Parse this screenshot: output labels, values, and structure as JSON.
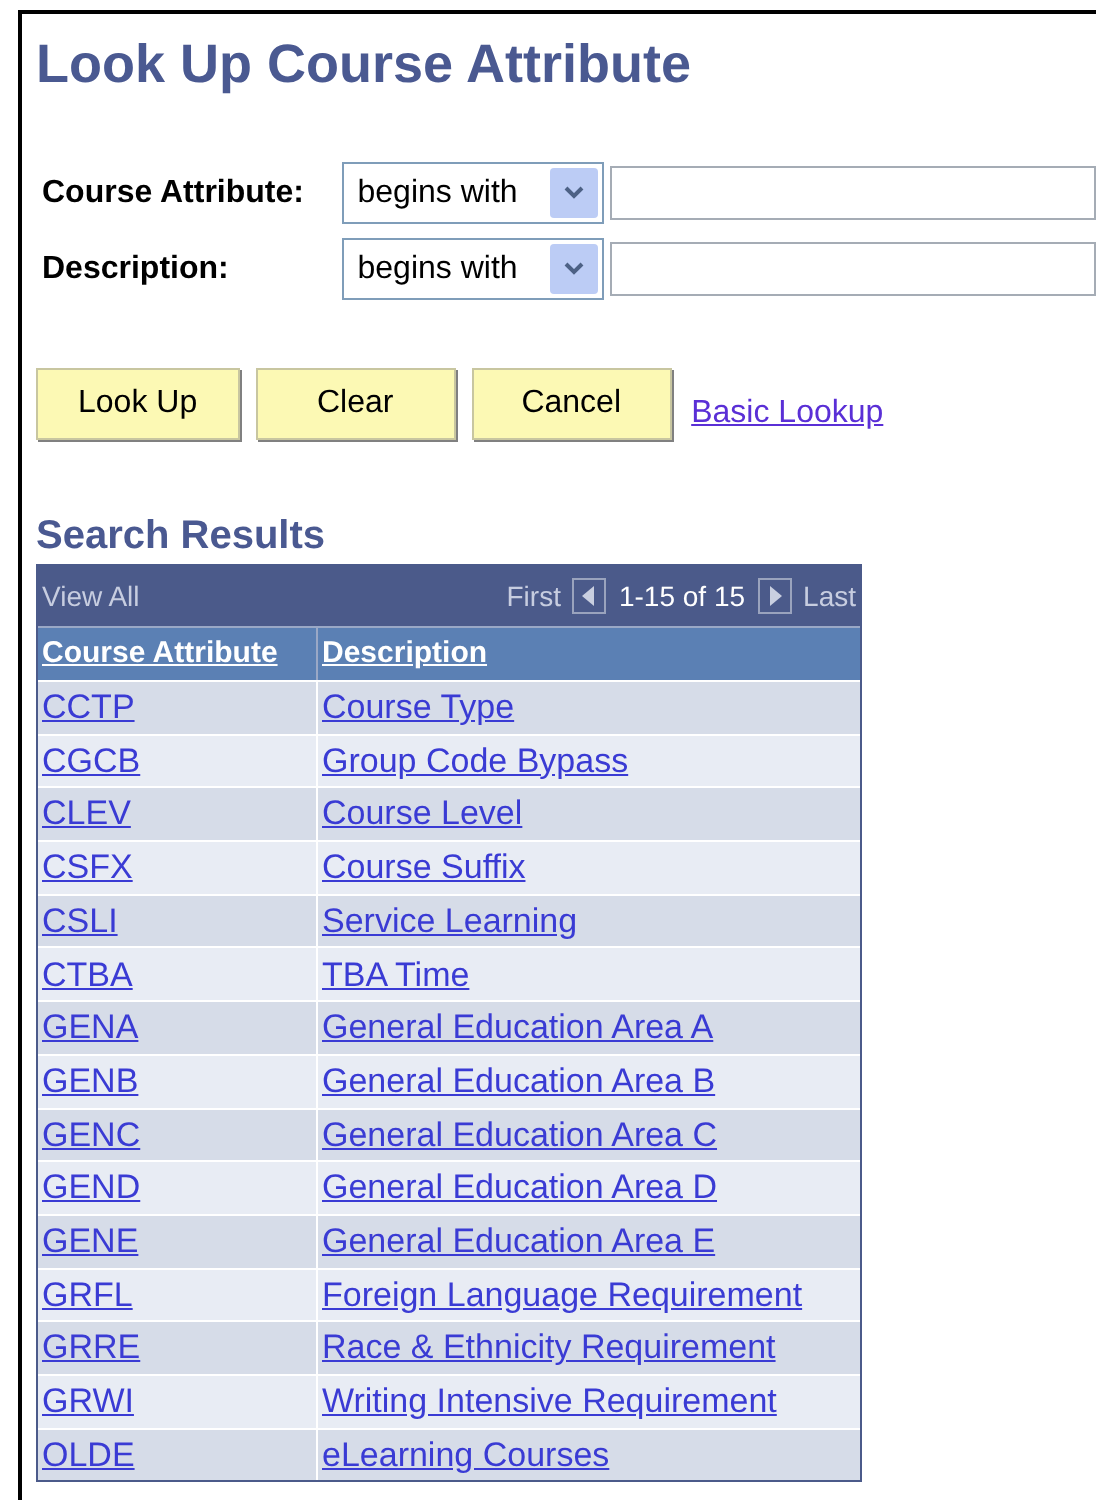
{
  "title": "Look Up Course Attribute",
  "criteria": [
    {
      "label": "Course Attribute:",
      "operator": "begins with"
    },
    {
      "label": "Description:",
      "operator": "begins with"
    }
  ],
  "buttons": [
    "Look Up",
    "Clear",
    "Cancel"
  ],
  "basic_lookup_link": "Basic Lookup",
  "results": {
    "heading": "Search Results",
    "view_all": "View All",
    "first": "First",
    "range": "1-15 of 15",
    "last": "Last",
    "columns": [
      "Course Attribute",
      "Description"
    ],
    "rows": [
      {
        "code": "CCTP",
        "description": "Course Type"
      },
      {
        "code": "CGCB",
        "description": "Group Code Bypass"
      },
      {
        "code": "CLEV",
        "description": "Course Level"
      },
      {
        "code": "CSFX",
        "description": "Course Suffix"
      },
      {
        "code": "CSLI",
        "description": "Service Learning"
      },
      {
        "code": "CTBA",
        "description": "TBA Time"
      },
      {
        "code": "GENA",
        "description": "General Education Area A"
      },
      {
        "code": "GENB",
        "description": "General Education Area B"
      },
      {
        "code": "GENC",
        "description": "General Education Area C"
      },
      {
        "code": "GEND",
        "description": "General Education Area D"
      },
      {
        "code": "GENE",
        "description": "General Education Area E"
      },
      {
        "code": "GRFL",
        "description": "Foreign Language Requirement"
      },
      {
        "code": "GRRE",
        "description": "Race & Ethnicity Requirement"
      },
      {
        "code": "GRWI",
        "description": "Writing Intensive Requirement"
      },
      {
        "code": "OLDE",
        "description": "eLearning Courses"
      }
    ]
  }
}
